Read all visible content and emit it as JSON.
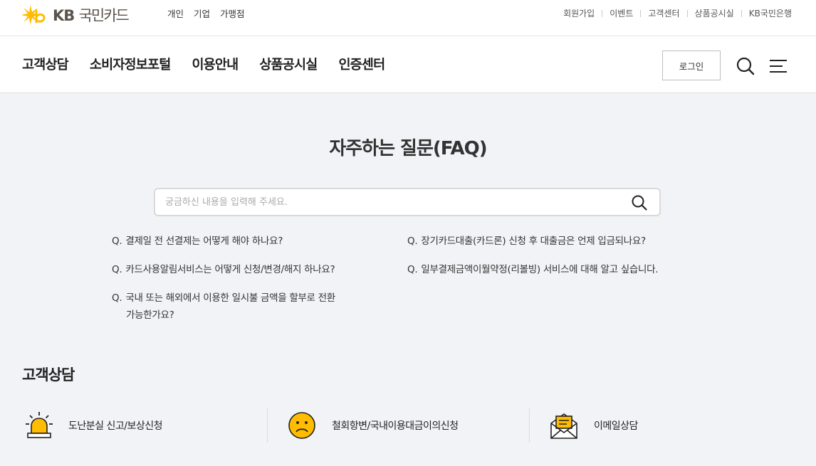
{
  "header": {
    "logo_text": "KB",
    "logo_text_ko": "국민카드",
    "segments": [
      "개인",
      "기업",
      "가맹점"
    ],
    "utility_links": [
      "회원가입",
      "이벤트",
      "고객센터",
      "상품공시실",
      "KB국민은행"
    ]
  },
  "nav": {
    "items": [
      "고객상담",
      "소비자정보포털",
      "이용안내",
      "상품공시실",
      "인증센터"
    ],
    "login_label": "로그인"
  },
  "faq": {
    "title": "자주하는 질문(FAQ)",
    "search_placeholder": "궁금하신 내용을 입력해 주세요.",
    "questions_left": [
      {
        "q": "Q.",
        "line1": "결제일 전 선결제는 어떻게 해야 하나요?",
        "line2": ""
      },
      {
        "q": "Q.",
        "line1": "카드사용알림서비스는 어떻게 신청/변경/해지 하나요?",
        "line2": ""
      },
      {
        "q": "Q.",
        "line1": "국내 또는 해외에서 이용한 일시불 금액을 할부로 전환",
        "line2": "가능한가요?"
      }
    ],
    "questions_right": [
      {
        "q": "Q.",
        "line1": "장기카드대출(카드론) 신청 후 대출금은 언제 입금되나요?"
      },
      {
        "q": "Q.",
        "line1": "일부결제금액이월약정(리볼빙) 서비스에 대해 알고 싶습니다."
      }
    ]
  },
  "consult": {
    "title": "고객상담",
    "items": [
      {
        "label": "도난분실 신고/보상신청",
        "icon": "siren-icon"
      },
      {
        "label": "철회항변/국내이용대금이의신청",
        "icon": "sad-face-icon"
      },
      {
        "label": "이메일상담",
        "icon": "email-icon"
      }
    ]
  },
  "colors": {
    "brand_yellow": "#ffbc00",
    "background": "#f1f3f6"
  }
}
